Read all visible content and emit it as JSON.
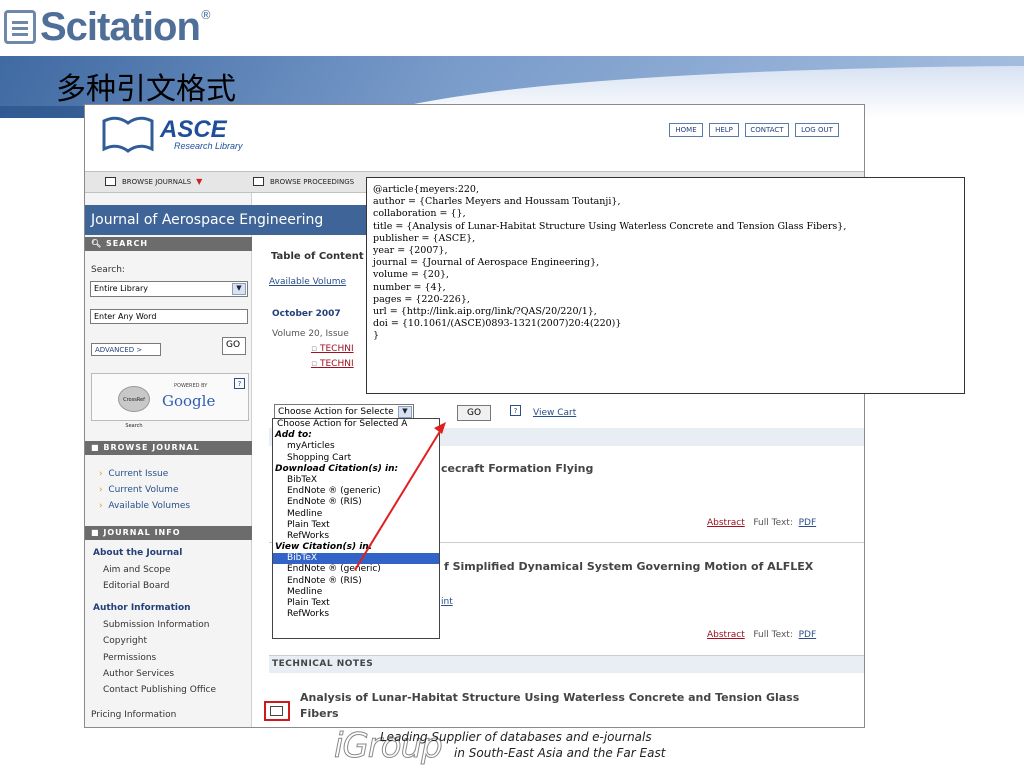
{
  "slide": {
    "title": "多种引文格式",
    "logo_text": "Scitation",
    "logo_reg": "®",
    "footer_mark": "iGroup",
    "footer_line1": "Leading Supplier of databases and e-journals",
    "footer_line2": "in South-East Asia and the Far East"
  },
  "header": {
    "logo_main": "ASCE",
    "logo_sub": "Research Library",
    "buttons": [
      "HOME",
      "HELP",
      "CONTACT",
      "LOG OUT"
    ]
  },
  "nav": {
    "browse_journals": "BROWSE JOURNALS",
    "browse_proceedings": "BROWSE PROCEEDINGS"
  },
  "sidebar": {
    "journal_title": "Journal of Aerospace Engineering",
    "search_head": "SEARCH",
    "search_label": "Search:",
    "search_scope": "Entire Library",
    "search_placeholder": "Enter Any Word",
    "advanced": "ADVANCED",
    "go": "GO",
    "powered_by": "POWERED BY",
    "crossref": "CrossRef Search",
    "google": "Google",
    "browse_head": "BROWSE JOURNAL",
    "browse_items": [
      "Current Issue",
      "Current Volume",
      "Available Volumes"
    ],
    "info_head": "JOURNAL INFO",
    "about_head": "About the Journal",
    "about_items": [
      "Aim and Scope",
      "Editorial Board"
    ],
    "author_head": "Author Information",
    "author_items": [
      "Submission Information",
      "Copyright",
      "Permissions",
      "Author Services",
      "Contact Publishing Office"
    ],
    "pricing": "Pricing Information"
  },
  "content": {
    "toc_title": "Table of Content",
    "available_volumes": "Available Volume",
    "issue_date": "October 2007",
    "volume_issue": "Volume 20, Issue",
    "technical1": "TECHNI",
    "technical2": "TECHNI",
    "action_select": "Choose Action for Selecte",
    "go": "GO",
    "view_cart": "View Cart",
    "article1_title": "cecraft Formation Flying",
    "article2_title": "f Simplified Dynamical System Governing Motion of ALFLEX",
    "article2_link": "int",
    "abstract": "Abstract",
    "full_text": "Full Text:",
    "pdf": "PDF",
    "tech_notes": "TECHNICAL NOTES",
    "article3_title_line1": "Analysis of Lunar-Habitat Structure Using Waterless Concrete and Tension Glass",
    "article3_title_line2": "Fibers",
    "row_numbers": [
      "1"
    ]
  },
  "dropdown": {
    "items": [
      {
        "label": "Choose Action for Selected A",
        "kind": "plain"
      },
      {
        "label": "Add to:",
        "kind": "head"
      },
      {
        "label": "myArticles",
        "kind": "item"
      },
      {
        "label": "Shopping Cart",
        "kind": "item"
      },
      {
        "label": "Download Citation(s) in:",
        "kind": "head"
      },
      {
        "label": "BibTeX",
        "kind": "item"
      },
      {
        "label": "EndNote ® (generic)",
        "kind": "item"
      },
      {
        "label": "EndNote ® (RIS)",
        "kind": "item"
      },
      {
        "label": "Medline",
        "kind": "item"
      },
      {
        "label": "Plain Text",
        "kind": "item"
      },
      {
        "label": "RefWorks",
        "kind": "item"
      },
      {
        "label": "View Citation(s) in:",
        "kind": "head"
      },
      {
        "label": "BibTeX",
        "kind": "selected"
      },
      {
        "label": "EndNote ® (generic)",
        "kind": "item"
      },
      {
        "label": "EndNote ® (RIS)",
        "kind": "item"
      },
      {
        "label": "Medline",
        "kind": "item"
      },
      {
        "label": "Plain Text",
        "kind": "item"
      },
      {
        "label": "RefWorks",
        "kind": "item"
      }
    ]
  },
  "citation": {
    "lines": [
      "@article{meyers:220,",
      "author = {Charles Meyers and Houssam Toutanji},",
      "collaboration = {},",
      "title = {Analysis of Lunar-Habitat Structure Using Waterless Concrete and Tension Glass Fibers},",
      "publisher = {ASCE},",
      "year = {2007},",
      "journal = {Journal of Aerospace Engineering},",
      "volume = {20},",
      "number = {4},",
      "pages = {220-226},",
      "url = {http://link.aip.org/link/?QAS/20/220/1},",
      "doi = {10.1061/(ASCE)0893-1321(2007)20:4(220)}",
      "}"
    ]
  },
  "colors": {
    "journal_bar": "#3f6598",
    "arrow": "#e02020",
    "selected": "#3264c8",
    "band": "#5a7fb8"
  }
}
